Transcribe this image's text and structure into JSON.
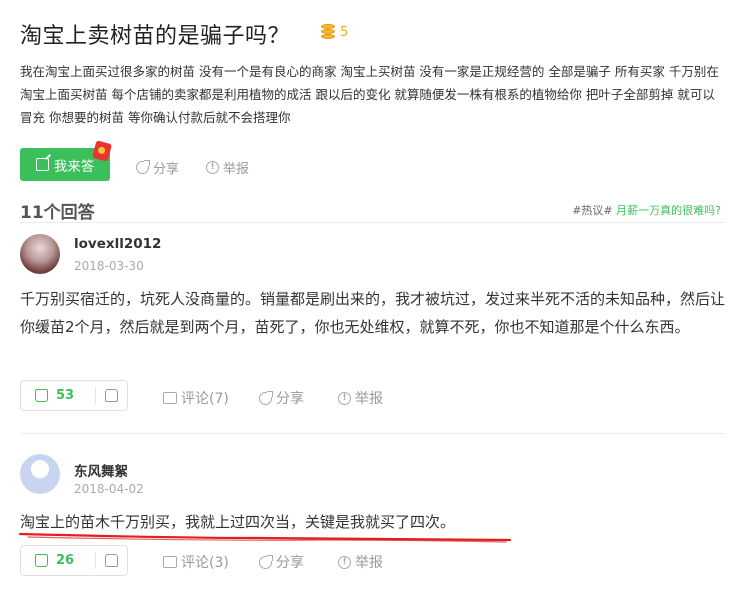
{
  "question": {
    "title": "淘宝上卖树苗的是骗子吗？",
    "reward": "5",
    "description": "我在淘宝上面买过很多家的树苗 没有一个是有良心的商家 淘宝上买树苗 没有一家是正规经营的 全部是骗子 所有买家 千万别在淘宝上面买树苗 每个店铺的卖家都是利用植物的成活 跟以后的变化 就算随便发一株有根系的植物给你 把叶子全部剪掉 就可以冒充 你想要的树苗 等你确认付款后就不会搭理你",
    "answer_button": "我来答",
    "share": "分享",
    "report": "举报"
  },
  "answers_header": {
    "count_label": "11个回答",
    "hot_prefix": "#热议#",
    "hot_topic": "月薪一万真的很难吗?"
  },
  "answers": [
    {
      "username": "lovexll2012",
      "date": "2018-03-30",
      "text": "千万别买宿迁的，坑死人没商量的。销量都是刷出来的，我才被坑过，发过来半死不活的未知品种，然后让你缓苗2个月，然后就是到两个月，苗死了，你也无处维权，就算不死，你也不知道那是个什么东西。",
      "likes": "53",
      "comments": "评论(7)",
      "share": "分享",
      "report": "举报"
    },
    {
      "username": "东风舞絮",
      "date": "2018-04-02",
      "text": "淘宝上的苗木千万别买，我就上过四次当，关键是我就买了四次。",
      "likes": "26",
      "comments": "评论(3)",
      "share": "分享",
      "report": "举报"
    }
  ],
  "colors": {
    "accent_green": "#3bbf5b",
    "reward_gold": "#f5a623",
    "underline_red": "#e02020"
  }
}
